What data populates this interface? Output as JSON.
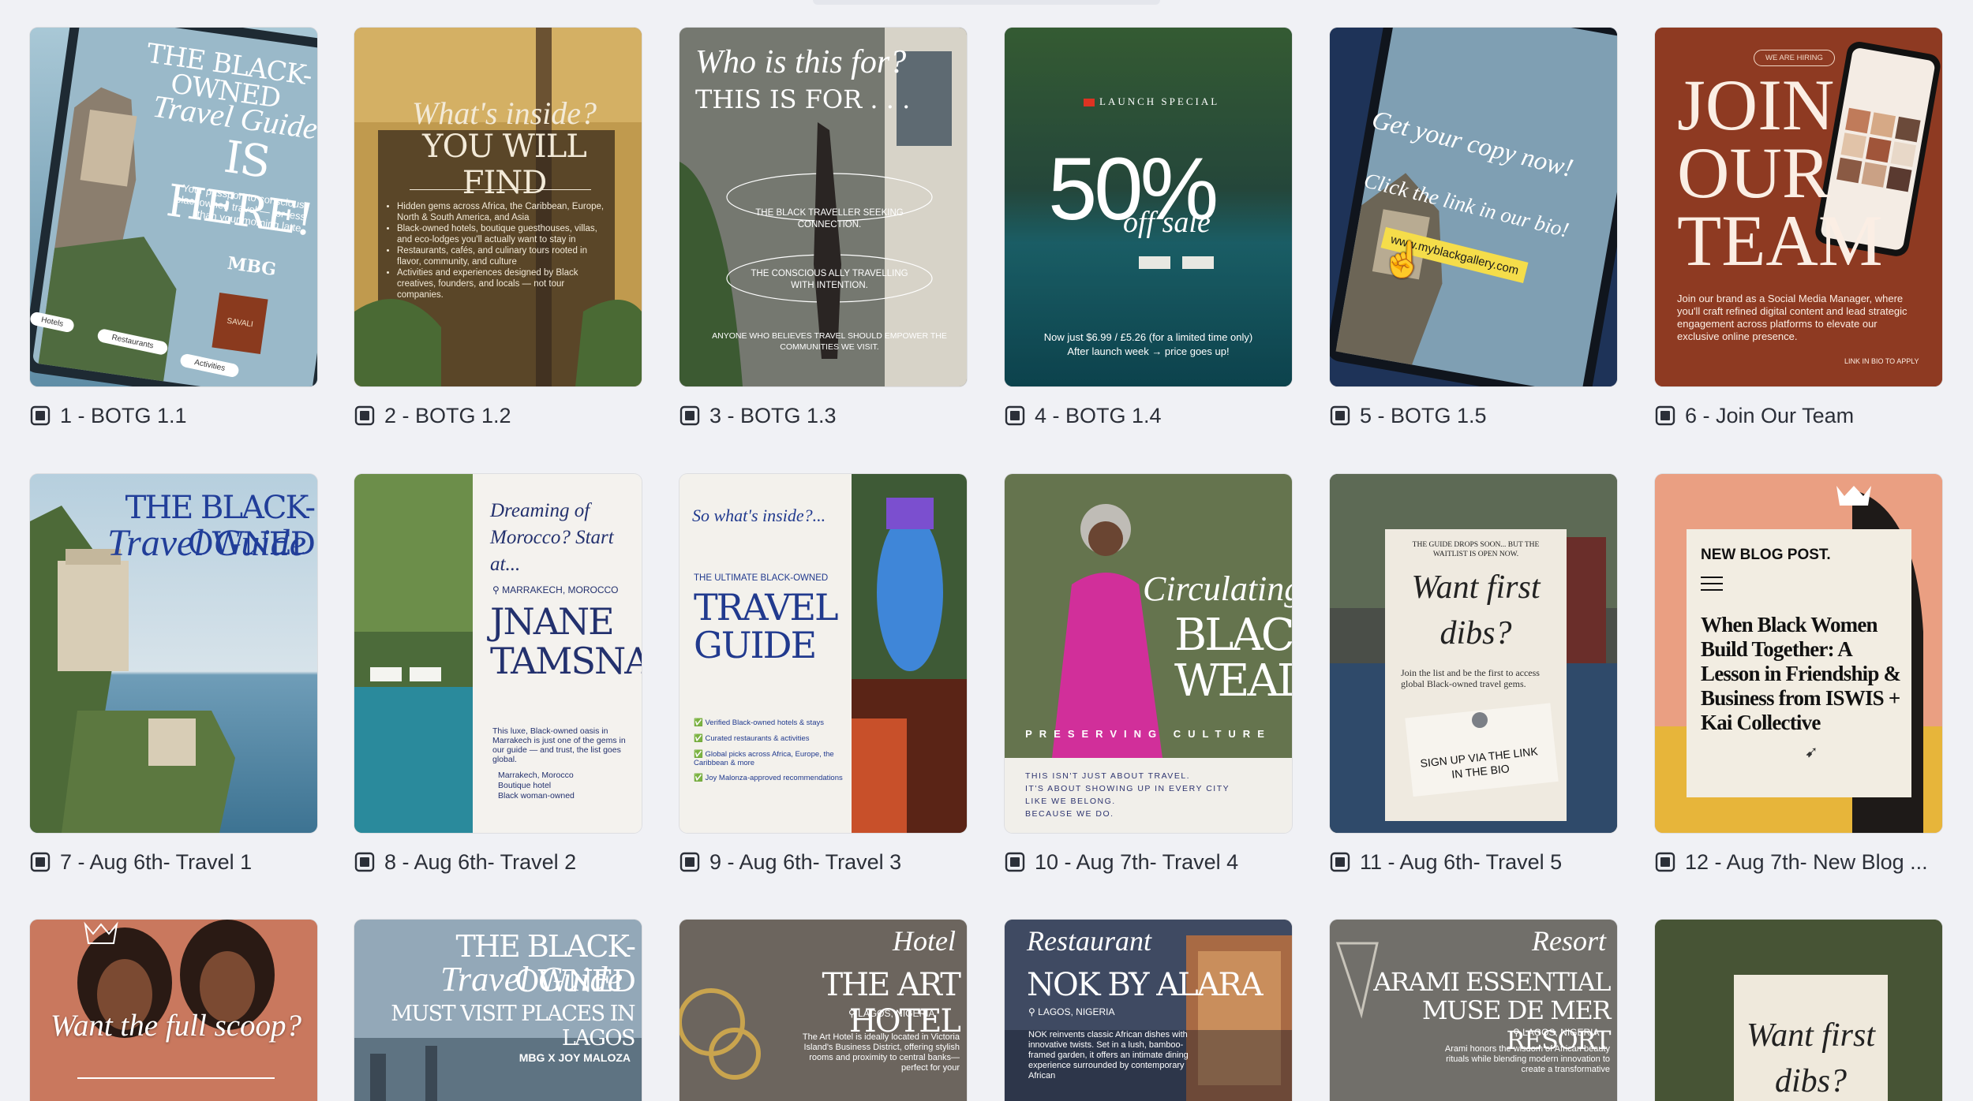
{
  "designs": [
    {
      "caption": "1 - BOTG 1.1",
      "art": {
        "title": "THE BLACK-OWNED",
        "script": "Travel Guide",
        "big": "IS HERE!",
        "sub": "Your passport to conscious, blackowned travel — for less than your morning latte.",
        "brand": "MBG",
        "badge": "SAVALI",
        "chips": [
          "Hotels",
          "Restaurants",
          "Activities"
        ]
      }
    },
    {
      "caption": "2 - BOTG 1.2",
      "art": {
        "script": "What's inside?",
        "title": "YOU WILL FIND",
        "bullets": [
          "Hidden gems across Africa, the Caribbean, Europe, North & South America, and Asia",
          "Black-owned hotels, boutique guesthouses, villas, and eco-lodges you'll actually want to stay in",
          "Restaurants, cafés, and culinary tours rooted in flavor, community, and culture",
          "Activities and experiences designed by Black creatives, founders, and locals — not tour companies."
        ]
      }
    },
    {
      "caption": "3 - BOTG 1.3",
      "art": {
        "script": "Who is this for?",
        "title": "THIS IS FOR . . .",
        "item1": "THE BLACK TRAVELLER SEEKING CONNECTION.",
        "item2": "THE CONSCIOUS ALLY TRAVELLING WITH INTENTION.",
        "item3": "ANYONE WHO BELIEVES TRAVEL SHOULD EMPOWER THE COMMUNITIES WE VISIT."
      }
    },
    {
      "caption": "4 - BOTG 1.4",
      "art": {
        "tag": "LAUNCH SPECIAL",
        "big": "50%",
        "script": "off sale",
        "line1": "Now just $6.99 / £5.26 (for a limited time only)",
        "line2": "After launch week → price goes up!"
      }
    },
    {
      "caption": "5 - BOTG 1.5",
      "art": {
        "script1": "Get your copy now!",
        "script2": "Click the link in our bio!",
        "link": "www.myblackgallery.com"
      }
    },
    {
      "caption": "6 - Join Our Team",
      "art": {
        "pill": "WE ARE HIRING",
        "big": [
          "JOIN",
          "OUR",
          "TEAM"
        ],
        "body": "Join our brand as a Social Media Manager, where you'll craft refined digital content and lead strategic engagement across platforms to elevate our exclusive online presence.",
        "foot": "LINK IN BIO TO APPLY"
      }
    },
    {
      "caption": "7 - Aug 6th- Travel 1",
      "art": {
        "title": "THE BLACK-OWNED",
        "script": "Travel Guide"
      }
    },
    {
      "caption": "8 - Aug 6th- Travel 2",
      "art": {
        "script": "Dreaming of Morocco? Start at...",
        "loc": "MARRAKECH, MOROCCO",
        "title": "JNANE TAMSNA",
        "body": "This luxe, Black-owned oasis in Marrakech is just one of the gems in our guide — and trust, the list goes global.",
        "l1": "Marrakech, Morocco",
        "l2": "Boutique hotel",
        "l3": "Black woman-owned"
      }
    },
    {
      "caption": "9 - Aug 6th- Travel 3",
      "art": {
        "script": "So what's inside?...",
        "kicker": "THE ULTIMATE BLACK-OWNED",
        "title": "TRAVEL GUIDE",
        "checks": [
          "Verified Black-owned hotels & stays",
          "Curated restaurants & activities",
          "Global picks across Africa, Europe, the Caribbean & more",
          "Joy Malonza-approved recommendations"
        ]
      }
    },
    {
      "caption": "10 - Aug 7th- Travel 4",
      "art": {
        "script": "Circulating",
        "title": "BLACK WEALTH",
        "spaced": "PRESERVING CULTURE",
        "l1": "THIS ISN'T JUST ABOUT TRAVEL.",
        "l2": "IT'S ABOUT SHOWING UP IN EVERY CITY",
        "l3": "LIKE WE BELONG.",
        "l4": "BECAUSE WE DO."
      }
    },
    {
      "caption": "11 - Aug 6th- Travel 5",
      "art": {
        "top": "THE GUIDE DROPS SOON... BUT THE WAITLIST IS OPEN NOW.",
        "script": "Want first dibs?",
        "body": "Join the list and be the first to access global Black-owned travel gems.",
        "note": "SIGN UP VIA THE LINK IN THE BIO"
      }
    },
    {
      "caption": "12 - Aug 7th- New Blog ...",
      "art": {
        "kicker": "NEW BLOG POST.",
        "title": "When Black Women Build Together: A Lesson in Friendship & Business from ISWIS + Kai Collective"
      }
    },
    {
      "caption": "",
      "art": {
        "script": "Want the full scoop?"
      }
    },
    {
      "caption": "",
      "art": {
        "title": "THE BLACK-OWNED",
        "script": "Travel Guide",
        "sub": "MUST VISIT PLACES IN LAGOS",
        "brand": "MBG X JOY MALOZA"
      }
    },
    {
      "caption": "",
      "art": {
        "script": "Hotel",
        "title": "THE ART HOTEL",
        "loc": "LAGOS, NIGERIA",
        "body": "The Art Hotel is ideally located in Victoria Island's Business District, offering stylish rooms and proximity to central banks—perfect for your"
      }
    },
    {
      "caption": "",
      "art": {
        "script": "Restaurant",
        "title": "NOK BY ALARA",
        "loc": "LAGOS, NIGERIA",
        "body": "NOK reinvents classic African dishes with innovative twists. Set in a lush, bamboo-framed garden, it offers an intimate dining experience surrounded by contemporary African"
      }
    },
    {
      "caption": "",
      "art": {
        "script": "Resort",
        "title1": "ARAMI ESSENTIAL",
        "title2": "MUSE DE MER RESORT",
        "loc": "LAGOS, NIGERIA",
        "body": "Arami honors the wisdom of African beauty rituals while blending modern innovation to create a transformative"
      }
    },
    {
      "caption": "",
      "art": {
        "script": "Want first dibs?"
      }
    }
  ],
  "colors": {
    "bg": "#f0f1f5",
    "caption": "#2b2f38",
    "icon": "#2b2f38"
  },
  "icon_name": "design-file-icon"
}
